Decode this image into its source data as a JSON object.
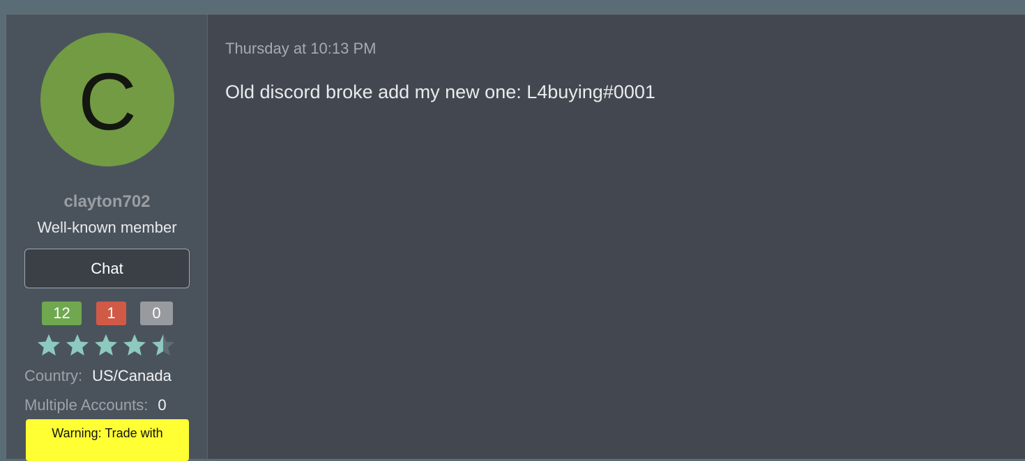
{
  "user": {
    "avatar_letter": "C",
    "avatar_color": "#729b44",
    "username": "clayton702",
    "title": "Well-known member",
    "chat_label": "Chat",
    "feedback": {
      "positive": "12",
      "negative": "1",
      "neutral": "0"
    },
    "rating": 4.5,
    "rating_max": 5,
    "fields": {
      "country_label": "Country:",
      "country_value": "US/Canada",
      "accounts_label": "Multiple Accounts:",
      "accounts_value": "0"
    },
    "warning": "Warning: Trade with"
  },
  "post": {
    "timestamp": "Thursday at 10:13 PM",
    "message": "Old discord broke add my new one: L4buying#0001"
  },
  "colors": {
    "positive": "#6fa84e",
    "negative": "#d15a47",
    "neutral": "#979b9f",
    "star_fill": "#8ec9c0",
    "star_empty": "#5f6b75",
    "warning_bg": "#ffff33"
  }
}
